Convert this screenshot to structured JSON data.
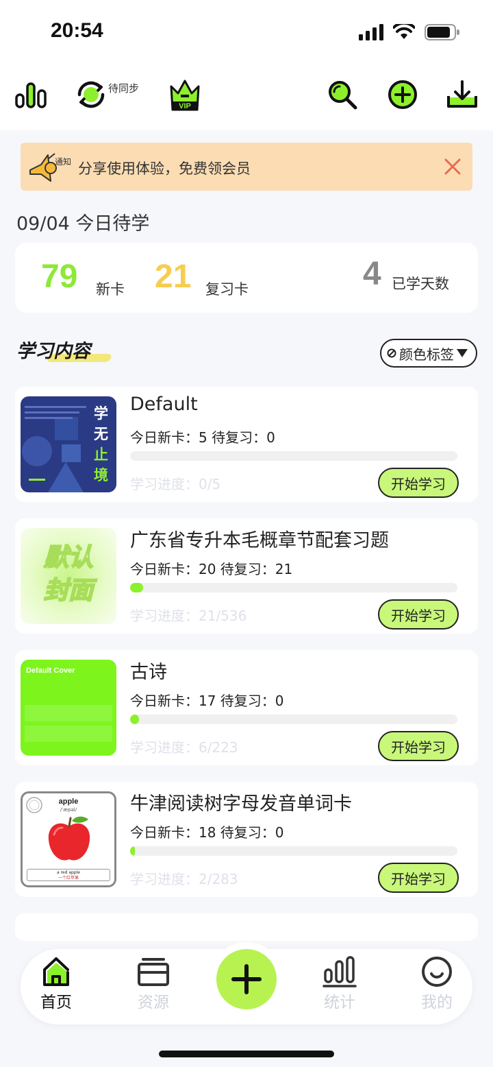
{
  "status_bar": {
    "time": "20:54"
  },
  "toolbar": {
    "sync_label": "待同步"
  },
  "notice": {
    "text": "分享使用体验，免费领会员",
    "badge": "通知"
  },
  "today": {
    "title": "09/04 今日待学"
  },
  "stats": {
    "new_count": "79",
    "new_label": "新卡",
    "review_count": "21",
    "review_label": "复习卡",
    "days_count": "4",
    "days_label": "已学天数"
  },
  "section": {
    "title": "学习内容",
    "color_tag_label": "颜色标签"
  },
  "decks": [
    {
      "name": "Default",
      "today": "今日新卡：5 待复习：0",
      "progress": "学习进度：0/5",
      "progress_fraction": 0.0,
      "button": "开始学习"
    },
    {
      "name": "广东省专升本毛概章节配套习题",
      "today": "今日新卡：20 待复习：21",
      "progress": "学习进度：21/536",
      "progress_fraction": 0.039,
      "button": "开始学习"
    },
    {
      "name": "古诗",
      "today": "今日新卡：17 待复习：0",
      "progress": "学习进度：6/223",
      "progress_fraction": 0.027,
      "button": "开始学习"
    },
    {
      "name": "牛津阅读树字母发音单词卡",
      "today": "今日新卡：18 待复习：0",
      "progress": "学习进度：2/283",
      "progress_fraction": 0.007,
      "button": "开始学习"
    }
  ],
  "covers": {
    "default": {
      "chars": [
        "学",
        "无",
        "止",
        "境"
      ]
    },
    "placeholder": {
      "text1": "默认",
      "text2": "封面"
    },
    "green": {
      "text": "Default Cover"
    },
    "apple": {
      "word": "apple",
      "phonetic": "/ˈæpəl/",
      "caption1": "a red apple",
      "caption2": "一个红苹果"
    }
  },
  "bottom_nav": {
    "home": "首页",
    "resources": "资源",
    "stats": "统计",
    "me": "我的"
  },
  "colors": {
    "accent": "#8df02c",
    "new_color": "#8ee83a",
    "review_color": "#f7cd4f"
  }
}
